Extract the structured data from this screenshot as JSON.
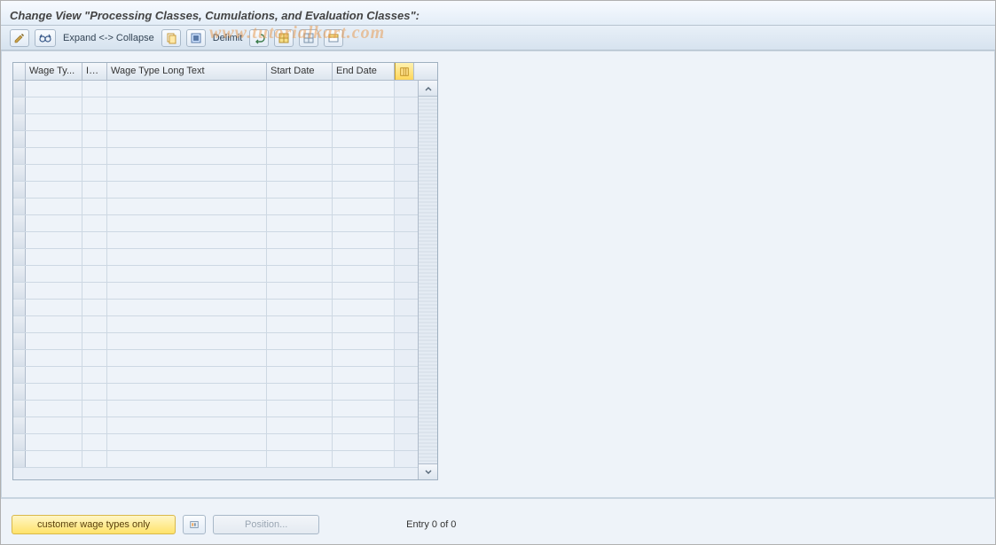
{
  "title": "Change View \"Processing Classes, Cumulations, and Evaluation Classes\":",
  "watermark": "www.tutorialkart.com",
  "toolbar": {
    "expand_collapse": "Expand <-> Collapse",
    "delimit": "Delimit"
  },
  "table": {
    "columns": {
      "wage_type": "Wage Ty...",
      "inf": "Inf...",
      "long_text": "Wage Type Long Text",
      "start_date": "Start Date",
      "end_date": "End Date"
    },
    "rows": [
      {
        "wage_type": "",
        "inf": "",
        "long_text": "",
        "start_date": "",
        "end_date": ""
      },
      {
        "wage_type": "",
        "inf": "",
        "long_text": "",
        "start_date": "",
        "end_date": ""
      },
      {
        "wage_type": "",
        "inf": "",
        "long_text": "",
        "start_date": "",
        "end_date": ""
      },
      {
        "wage_type": "",
        "inf": "",
        "long_text": "",
        "start_date": "",
        "end_date": ""
      },
      {
        "wage_type": "",
        "inf": "",
        "long_text": "",
        "start_date": "",
        "end_date": ""
      },
      {
        "wage_type": "",
        "inf": "",
        "long_text": "",
        "start_date": "",
        "end_date": ""
      },
      {
        "wage_type": "",
        "inf": "",
        "long_text": "",
        "start_date": "",
        "end_date": ""
      },
      {
        "wage_type": "",
        "inf": "",
        "long_text": "",
        "start_date": "",
        "end_date": ""
      },
      {
        "wage_type": "",
        "inf": "",
        "long_text": "",
        "start_date": "",
        "end_date": ""
      },
      {
        "wage_type": "",
        "inf": "",
        "long_text": "",
        "start_date": "",
        "end_date": ""
      },
      {
        "wage_type": "",
        "inf": "",
        "long_text": "",
        "start_date": "",
        "end_date": ""
      },
      {
        "wage_type": "",
        "inf": "",
        "long_text": "",
        "start_date": "",
        "end_date": ""
      },
      {
        "wage_type": "",
        "inf": "",
        "long_text": "",
        "start_date": "",
        "end_date": ""
      },
      {
        "wage_type": "",
        "inf": "",
        "long_text": "",
        "start_date": "",
        "end_date": ""
      },
      {
        "wage_type": "",
        "inf": "",
        "long_text": "",
        "start_date": "",
        "end_date": ""
      },
      {
        "wage_type": "",
        "inf": "",
        "long_text": "",
        "start_date": "",
        "end_date": ""
      },
      {
        "wage_type": "",
        "inf": "",
        "long_text": "",
        "start_date": "",
        "end_date": ""
      },
      {
        "wage_type": "",
        "inf": "",
        "long_text": "",
        "start_date": "",
        "end_date": ""
      },
      {
        "wage_type": "",
        "inf": "",
        "long_text": "",
        "start_date": "",
        "end_date": ""
      },
      {
        "wage_type": "",
        "inf": "",
        "long_text": "",
        "start_date": "",
        "end_date": ""
      },
      {
        "wage_type": "",
        "inf": "",
        "long_text": "",
        "start_date": "",
        "end_date": ""
      },
      {
        "wage_type": "",
        "inf": "",
        "long_text": "",
        "start_date": "",
        "end_date": ""
      },
      {
        "wage_type": "",
        "inf": "",
        "long_text": "",
        "start_date": "",
        "end_date": ""
      }
    ]
  },
  "footer": {
    "customer_wage": "customer wage types only",
    "position": "Position...",
    "entry": "Entry 0 of 0"
  }
}
